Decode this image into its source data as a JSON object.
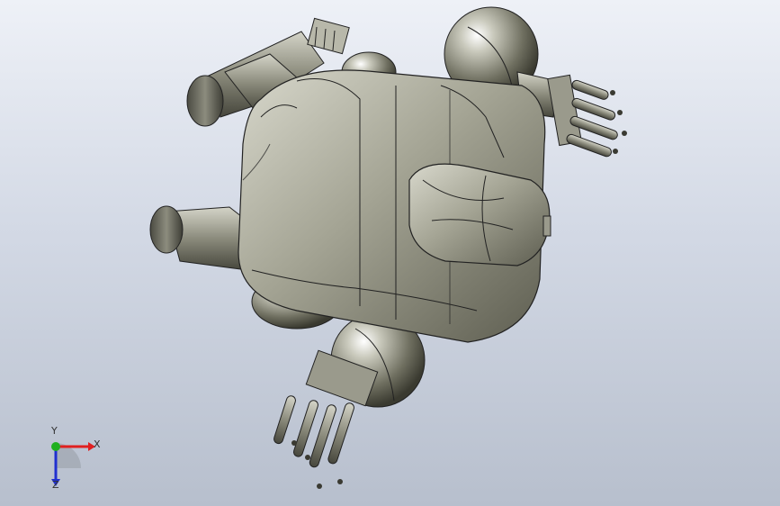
{
  "viewport": {
    "background_top": "#eef1f7",
    "background_bottom": "#b7bfcd"
  },
  "triad": {
    "x_label": "X",
    "y_label": "Y",
    "z_label": "Z",
    "x_color": "#e02020",
    "y_color": "#20b020",
    "z_color": "#2030d0"
  }
}
